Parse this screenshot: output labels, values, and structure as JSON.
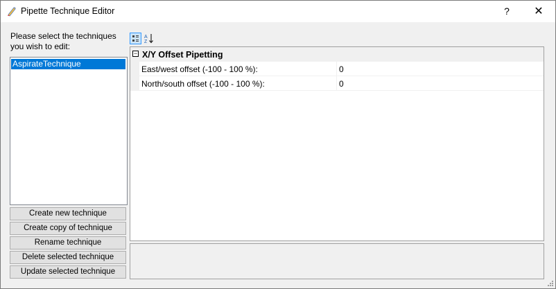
{
  "window": {
    "title": "Pipette Technique Editor",
    "help_label": "?",
    "close_label": "✕",
    "icon": "pencil-icon"
  },
  "left": {
    "prompt": "Please select the techniques you wish to edit:",
    "techniques": [
      "AspirateTechnique"
    ],
    "buttons": {
      "create_new": "Create new technique",
      "create_copy": "Create copy of technique",
      "rename": "Rename technique",
      "delete": "Delete selected technique",
      "update": "Update selected technique"
    }
  },
  "grid": {
    "toolbar": {
      "categorized_icon": "categorized-view-icon",
      "alphabetical_icon": "alphabetical-sort-icon"
    },
    "category": {
      "label": "X/Y Offset Pipetting",
      "toggle": "⊟"
    },
    "properties": [
      {
        "name": "East/west offset (-100 - 100 %):",
        "value": "0"
      },
      {
        "name": "North/south offset (-100 - 100 %):",
        "value": "0"
      }
    ]
  }
}
